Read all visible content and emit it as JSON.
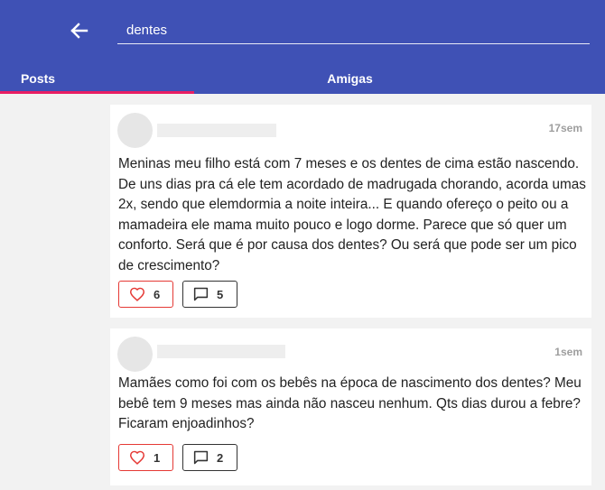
{
  "header": {
    "back_icon": "arrow-left-icon",
    "search_value": "dentes"
  },
  "tabs": [
    {
      "label": "Posts",
      "active": true
    },
    {
      "label": "Amigas",
      "active": false
    }
  ],
  "colors": {
    "appbar": "#3f51b5",
    "tab_indicator": "#e91e63",
    "like": "#e53935"
  },
  "posts": [
    {
      "time": "17sem",
      "text": "Meninas meu filho está com 7 meses e os dentes de cima estão nascendo. De uns dias pra cá ele tem acordado de madrugada chorando, acorda umas 2x, sendo que elemdormia a noite inteira... E quando ofereço o peito ou a mamadeira ele mama muito pouco e logo dorme. Parece que só quer um conforto. Será que é por causa dos dentes? Ou será que pode ser um pico de crescimento?",
      "likes": "6",
      "comments": "5"
    },
    {
      "time": "1sem",
      "text": "Mamães como foi com os bebês na época de nascimento dos dentes? Meu bebê tem 9 meses mas ainda não nasceu nenhum. Qts dias durou a febre? Ficaram enjoadinhos?",
      "likes": "1",
      "comments": "2"
    }
  ]
}
